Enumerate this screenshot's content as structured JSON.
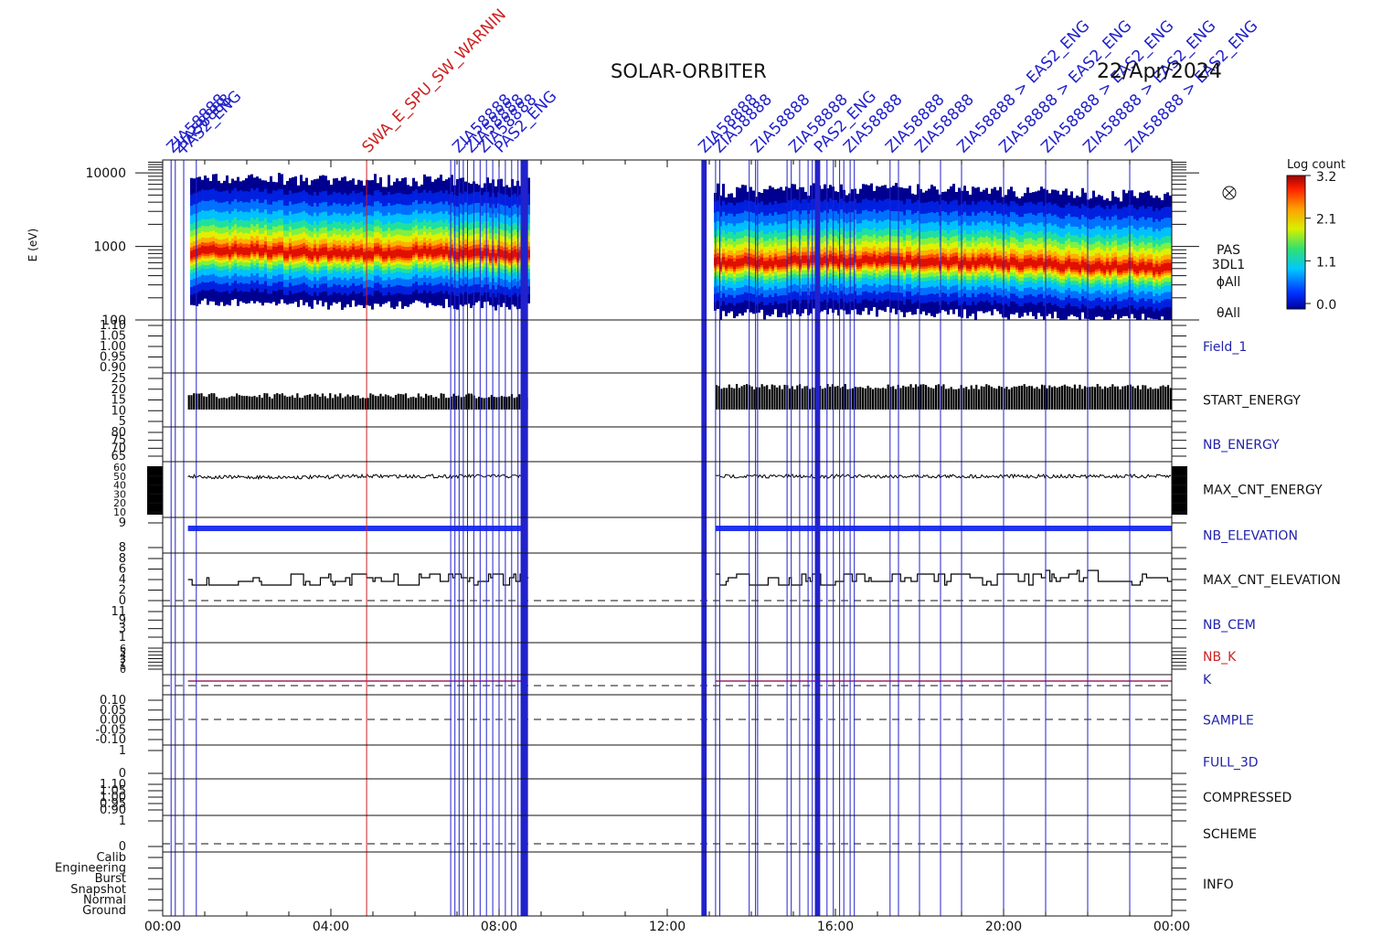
{
  "header": {
    "mission": "SOLAR-ORBITER",
    "date": "22/Apr/2024"
  },
  "colors": {
    "event_blue": "#2222cc",
    "warning_red": "#cc2222",
    "trace": "#000000",
    "label_blue": "#2222aa",
    "label_red": "#cc2222"
  },
  "colorbar": {
    "title": "Log count",
    "ticks": [
      "3.2",
      "2.1",
      "1.1",
      "0.0"
    ],
    "range": [
      0.0,
      3.2
    ]
  },
  "chart_data": {
    "type": "heatmap",
    "x_axis": {
      "range": [
        "00:00",
        "24:00"
      ],
      "tick_labels": [
        "00:00",
        "04:00",
        "08:00",
        "12:00",
        "16:00",
        "20:00",
        "00:00"
      ]
    },
    "data_gaps_hours": [
      [
        8.7,
        13.1
      ]
    ],
    "spectrogram": {
      "ylabel": "E (eV)",
      "scale": "log",
      "ylim": [
        100,
        15000
      ],
      "tick_labels": [
        "10000",
        "1000",
        "100"
      ],
      "peak_energy_ev_by_hour": [
        [
          0.5,
          850
        ],
        [
          2.0,
          900
        ],
        [
          4.0,
          800
        ],
        [
          6.0,
          850
        ],
        [
          8.5,
          750
        ],
        [
          13.2,
          600
        ],
        [
          16.0,
          650
        ],
        [
          20.0,
          600
        ],
        [
          24.0,
          500
        ]
      ],
      "right_labels": [
        "PAS",
        "3DL1",
        "ϕAll",
        "θAll"
      ]
    },
    "panels": [
      {
        "name": "Field_1",
        "tick_labels": [
          "1.10",
          "1.05",
          "1.00",
          "0.95",
          "0.90"
        ],
        "label_color": "blue"
      },
      {
        "name": "START_ENERGY",
        "tick_labels": [
          "25",
          "20",
          "15",
          "10",
          "5"
        ],
        "label_color": "black",
        "typical_range": [
          13,
          20
        ]
      },
      {
        "name": "NB_ENERGY",
        "tick_labels": [
          "80",
          "75",
          "70",
          "65"
        ],
        "label_color": "blue"
      },
      {
        "name": "MAX_CNT_ENERGY",
        "tick_labels": [
          "60",
          "50",
          "40",
          "30",
          "20",
          "10"
        ],
        "label_color": "black",
        "typical_value": 54
      },
      {
        "name": "NB_ELEVATION",
        "tick_labels": [
          "9",
          "8"
        ],
        "label_color": "blue",
        "typical_value": 9
      },
      {
        "name": "MAX_CNT_ELEVATION",
        "tick_labels": [
          "8",
          "6",
          "4",
          "2",
          "0"
        ],
        "label_color": "black",
        "typical_range": [
          3,
          5
        ]
      },
      {
        "name": "NB_CEM",
        "tick_labels": [
          "11",
          "9",
          "3",
          "1"
        ],
        "label_color": "blue"
      },
      {
        "name": "NB_K",
        "tick_labels": [
          "6",
          "5",
          "4",
          "3",
          "2",
          "1",
          "0"
        ],
        "label_color": "red"
      },
      {
        "name": "K",
        "tick_labels": [],
        "label_color": "blue",
        "typical_value": 1
      },
      {
        "name": "SAMPLE",
        "tick_labels": [
          "0.10",
          "0.05",
          "0.00",
          "-0.05",
          "-0.10"
        ],
        "label_color": "blue"
      },
      {
        "name": "FULL_3D",
        "tick_labels": [
          "1",
          "0"
        ],
        "label_color": "blue"
      },
      {
        "name": "COMPRESSED",
        "tick_labels": [
          "1.10",
          "1.05",
          "1.00",
          "0.95",
          "0.90"
        ],
        "label_color": "black"
      },
      {
        "name": "SCHEME",
        "tick_labels": [
          "1",
          "0"
        ],
        "label_color": "black"
      },
      {
        "name": "INFO",
        "tick_labels": [
          "Calib",
          "Engineering",
          "Burst",
          "Snapshot",
          "Normal",
          "Ground"
        ],
        "label_color": "black"
      }
    ],
    "event_markers": {
      "labels": [
        "ZIA58888",
        "PAS2_ENG",
        "EAS2_ENG",
        "SWA_E_SPU_SW_WARNIN"
      ],
      "blue_event_hours": [
        0.2,
        0.3,
        0.5,
        0.8,
        6.85,
        6.95,
        7.05,
        7.15,
        7.25,
        7.4,
        7.55,
        7.7,
        7.85,
        8.0,
        8.15,
        8.3,
        8.45,
        8.55,
        8.6,
        8.65,
        12.85,
        12.9,
        13.15,
        13.25,
        13.95,
        14.1,
        14.15,
        14.85,
        14.95,
        15.15,
        15.35,
        15.45,
        15.55,
        15.6,
        15.8,
        15.95,
        16.1,
        16.2,
        16.35,
        16.45,
        17.3,
        17.5,
        18.0,
        18.5,
        19.0,
        20.0,
        21.0,
        22.0,
        23.0
      ],
      "red_event_hours": [
        4.85
      ],
      "rotated_label_hours": [
        [
          0.2,
          "ZIA58888"
        ],
        [
          0.35,
          "ZIA58888"
        ],
        [
          0.5,
          "PAS2_ENG"
        ],
        [
          4.85,
          "SWA_E_SPU_SW_WARNIN"
        ],
        [
          7.0,
          "ZIA58888"
        ],
        [
          7.3,
          "ZIA58888"
        ],
        [
          7.6,
          "ZIA58888"
        ],
        [
          8.0,
          "PAS2_ENG"
        ],
        [
          12.85,
          "ZIA58888"
        ],
        [
          13.2,
          "ZIA58888"
        ],
        [
          14.1,
          "ZIA58888"
        ],
        [
          15.0,
          "ZIA58888"
        ],
        [
          15.6,
          "PAS2_ENG"
        ],
        [
          16.3,
          "ZIA58888"
        ],
        [
          17.3,
          "ZIA58888"
        ],
        [
          18.0,
          "ZIA58888"
        ],
        [
          19.0,
          "ZIA58888 > EAS2_ENG"
        ],
        [
          20.0,
          "ZIA58888 > EAS2_ENG"
        ],
        [
          21.0,
          "ZIA58888 > EAS2_ENG"
        ],
        [
          22.0,
          "ZIA58888 > EAS2_ENG"
        ],
        [
          23.0,
          "ZIA58888 > EAS2_ENG"
        ]
      ]
    }
  }
}
